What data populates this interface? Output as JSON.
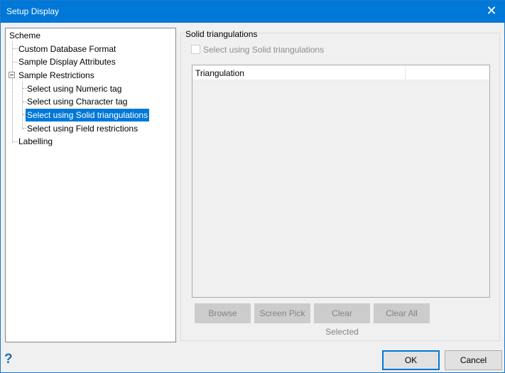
{
  "window": {
    "title": "Setup Display",
    "close_icon": "close-icon"
  },
  "tree": {
    "items": [
      {
        "label": "Scheme"
      },
      {
        "label": "Custom Database Format"
      },
      {
        "label": "Sample Display Attributes"
      },
      {
        "label": "Sample Restrictions"
      },
      {
        "label": "Select using Numeric tag"
      },
      {
        "label": "Select using Character tag"
      },
      {
        "label": "Select using Solid triangulations",
        "selected": true
      },
      {
        "label": "Select using Field restrictions"
      },
      {
        "label": "Labelling"
      }
    ]
  },
  "panel": {
    "group_label": "Solid triangulations",
    "checkbox_label": "Select using Solid triangulations",
    "checkbox_checked": false,
    "list_columns": [
      "Triangulation",
      ""
    ],
    "buttons": [
      "Browse",
      "Screen Pick",
      "Clear Selected",
      "Clear All"
    ]
  },
  "footer": {
    "help": "?",
    "ok": "OK",
    "cancel": "Cancel"
  },
  "colors": {
    "accent": "#0078d7"
  }
}
